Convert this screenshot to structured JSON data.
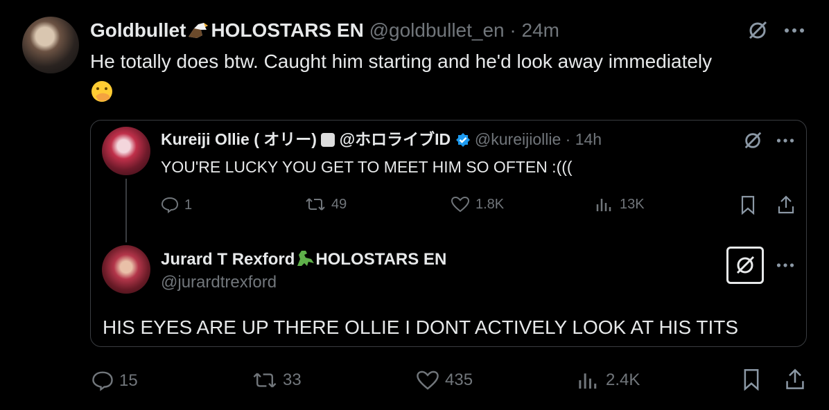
{
  "tweet": {
    "display_name": "Goldbullet",
    "name_suffix": "HOLOSTARS EN",
    "handle": "@goldbullet_en",
    "separator": "·",
    "time": "24m",
    "text": "He totally does btw. Caught him starting and he'd look away immediately",
    "emoji": "hand-over-mouth-emoji",
    "metrics": {
      "replies": "15",
      "reposts": "33",
      "likes": "435",
      "views": "2.4K"
    }
  },
  "quoted": {
    "display_name": "Kureiji Ollie ( オリー)",
    "name_suffix": "@ホロライブID",
    "handle": "@kureijiollie",
    "separator": "·",
    "time": "14h",
    "text": "YOU'RE LUCKY YOU GET TO MEET HIM SO OFTEN :(((",
    "metrics": {
      "replies": "1",
      "reposts": "49",
      "likes": "1.8K",
      "views": "13K"
    },
    "verified_color": "#1d9bf0"
  },
  "reply": {
    "display_name": "Jurard T Rexford",
    "name_suffix": "HOLOSTARS EN",
    "handle": "@jurardtrexford",
    "text": "HIS EYES ARE UP THERE OLLIE I DONT ACTIVELY LOOK AT HIS TITS"
  },
  "icons": [
    "grok-icon",
    "more-icon",
    "reply-icon",
    "repost-icon",
    "like-icon",
    "views-icon",
    "bookmark-icon",
    "share-icon",
    "verified-badge-icon",
    "eagle-emoji",
    "dinosaur-emoji"
  ],
  "colors": {
    "background": "#000000",
    "text": "#e7e9ea",
    "muted": "#71767b",
    "border": "#3a3d41",
    "verified": "#1d9bf0"
  }
}
